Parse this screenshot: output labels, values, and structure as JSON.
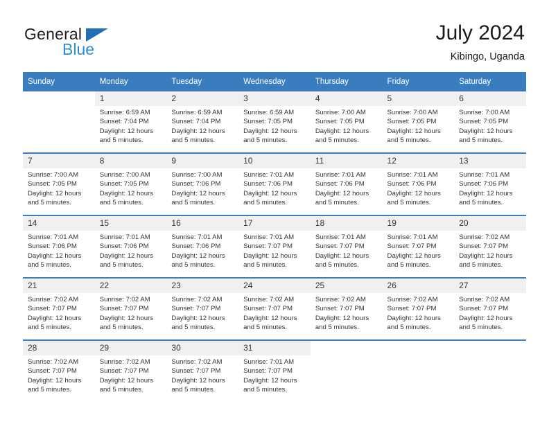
{
  "brand": {
    "name_part1": "General",
    "name_part2": "Blue",
    "triangle_color": "#1f6fb5",
    "blue_color": "#2b8fd4"
  },
  "header": {
    "title": "July 2024",
    "subtitle": "Kibingo, Uganda"
  },
  "colors": {
    "header_row_bg": "#3a7dbf",
    "daynum_bg": "#f0f0f0",
    "text": "#333333"
  },
  "weekday_headers": [
    "Sunday",
    "Monday",
    "Tuesday",
    "Wednesday",
    "Thursday",
    "Friday",
    "Saturday"
  ],
  "labels": {
    "sunrise_prefix": "Sunrise:",
    "sunset_prefix": "Sunset:",
    "daylight_prefix": "Daylight:"
  },
  "weeks": [
    [
      {
        "day": "",
        "empty": true
      },
      {
        "day": "1",
        "line1": "Sunrise: 6:59 AM",
        "line2": "Sunset: 7:04 PM",
        "line3": "Daylight: 12 hours",
        "line4": "and 5 minutes."
      },
      {
        "day": "2",
        "line1": "Sunrise: 6:59 AM",
        "line2": "Sunset: 7:04 PM",
        "line3": "Daylight: 12 hours",
        "line4": "and 5 minutes."
      },
      {
        "day": "3",
        "line1": "Sunrise: 6:59 AM",
        "line2": "Sunset: 7:05 PM",
        "line3": "Daylight: 12 hours",
        "line4": "and 5 minutes."
      },
      {
        "day": "4",
        "line1": "Sunrise: 7:00 AM",
        "line2": "Sunset: 7:05 PM",
        "line3": "Daylight: 12 hours",
        "line4": "and 5 minutes."
      },
      {
        "day": "5",
        "line1": "Sunrise: 7:00 AM",
        "line2": "Sunset: 7:05 PM",
        "line3": "Daylight: 12 hours",
        "line4": "and 5 minutes."
      },
      {
        "day": "6",
        "line1": "Sunrise: 7:00 AM",
        "line2": "Sunset: 7:05 PM",
        "line3": "Daylight: 12 hours",
        "line4": "and 5 minutes."
      }
    ],
    [
      {
        "day": "7",
        "line1": "Sunrise: 7:00 AM",
        "line2": "Sunset: 7:05 PM",
        "line3": "Daylight: 12 hours",
        "line4": "and 5 minutes."
      },
      {
        "day": "8",
        "line1": "Sunrise: 7:00 AM",
        "line2": "Sunset: 7:05 PM",
        "line3": "Daylight: 12 hours",
        "line4": "and 5 minutes."
      },
      {
        "day": "9",
        "line1": "Sunrise: 7:00 AM",
        "line2": "Sunset: 7:06 PM",
        "line3": "Daylight: 12 hours",
        "line4": "and 5 minutes."
      },
      {
        "day": "10",
        "line1": "Sunrise: 7:01 AM",
        "line2": "Sunset: 7:06 PM",
        "line3": "Daylight: 12 hours",
        "line4": "and 5 minutes."
      },
      {
        "day": "11",
        "line1": "Sunrise: 7:01 AM",
        "line2": "Sunset: 7:06 PM",
        "line3": "Daylight: 12 hours",
        "line4": "and 5 minutes."
      },
      {
        "day": "12",
        "line1": "Sunrise: 7:01 AM",
        "line2": "Sunset: 7:06 PM",
        "line3": "Daylight: 12 hours",
        "line4": "and 5 minutes."
      },
      {
        "day": "13",
        "line1": "Sunrise: 7:01 AM",
        "line2": "Sunset: 7:06 PM",
        "line3": "Daylight: 12 hours",
        "line4": "and 5 minutes."
      }
    ],
    [
      {
        "day": "14",
        "line1": "Sunrise: 7:01 AM",
        "line2": "Sunset: 7:06 PM",
        "line3": "Daylight: 12 hours",
        "line4": "and 5 minutes."
      },
      {
        "day": "15",
        "line1": "Sunrise: 7:01 AM",
        "line2": "Sunset: 7:06 PM",
        "line3": "Daylight: 12 hours",
        "line4": "and 5 minutes."
      },
      {
        "day": "16",
        "line1": "Sunrise: 7:01 AM",
        "line2": "Sunset: 7:06 PM",
        "line3": "Daylight: 12 hours",
        "line4": "and 5 minutes."
      },
      {
        "day": "17",
        "line1": "Sunrise: 7:01 AM",
        "line2": "Sunset: 7:07 PM",
        "line3": "Daylight: 12 hours",
        "line4": "and 5 minutes."
      },
      {
        "day": "18",
        "line1": "Sunrise: 7:01 AM",
        "line2": "Sunset: 7:07 PM",
        "line3": "Daylight: 12 hours",
        "line4": "and 5 minutes."
      },
      {
        "day": "19",
        "line1": "Sunrise: 7:01 AM",
        "line2": "Sunset: 7:07 PM",
        "line3": "Daylight: 12 hours",
        "line4": "and 5 minutes."
      },
      {
        "day": "20",
        "line1": "Sunrise: 7:02 AM",
        "line2": "Sunset: 7:07 PM",
        "line3": "Daylight: 12 hours",
        "line4": "and 5 minutes."
      }
    ],
    [
      {
        "day": "21",
        "line1": "Sunrise: 7:02 AM",
        "line2": "Sunset: 7:07 PM",
        "line3": "Daylight: 12 hours",
        "line4": "and 5 minutes."
      },
      {
        "day": "22",
        "line1": "Sunrise: 7:02 AM",
        "line2": "Sunset: 7:07 PM",
        "line3": "Daylight: 12 hours",
        "line4": "and 5 minutes."
      },
      {
        "day": "23",
        "line1": "Sunrise: 7:02 AM",
        "line2": "Sunset: 7:07 PM",
        "line3": "Daylight: 12 hours",
        "line4": "and 5 minutes."
      },
      {
        "day": "24",
        "line1": "Sunrise: 7:02 AM",
        "line2": "Sunset: 7:07 PM",
        "line3": "Daylight: 12 hours",
        "line4": "and 5 minutes."
      },
      {
        "day": "25",
        "line1": "Sunrise: 7:02 AM",
        "line2": "Sunset: 7:07 PM",
        "line3": "Daylight: 12 hours",
        "line4": "and 5 minutes."
      },
      {
        "day": "26",
        "line1": "Sunrise: 7:02 AM",
        "line2": "Sunset: 7:07 PM",
        "line3": "Daylight: 12 hours",
        "line4": "and 5 minutes."
      },
      {
        "day": "27",
        "line1": "Sunrise: 7:02 AM",
        "line2": "Sunset: 7:07 PM",
        "line3": "Daylight: 12 hours",
        "line4": "and 5 minutes."
      }
    ],
    [
      {
        "day": "28",
        "line1": "Sunrise: 7:02 AM",
        "line2": "Sunset: 7:07 PM",
        "line3": "Daylight: 12 hours",
        "line4": "and 5 minutes."
      },
      {
        "day": "29",
        "line1": "Sunrise: 7:02 AM",
        "line2": "Sunset: 7:07 PM",
        "line3": "Daylight: 12 hours",
        "line4": "and 5 minutes."
      },
      {
        "day": "30",
        "line1": "Sunrise: 7:02 AM",
        "line2": "Sunset: 7:07 PM",
        "line3": "Daylight: 12 hours",
        "line4": "and 5 minutes."
      },
      {
        "day": "31",
        "line1": "Sunrise: 7:01 AM",
        "line2": "Sunset: 7:07 PM",
        "line3": "Daylight: 12 hours",
        "line4": "and 5 minutes."
      },
      {
        "day": "",
        "empty": true
      },
      {
        "day": "",
        "empty": true
      },
      {
        "day": "",
        "empty": true
      }
    ]
  ]
}
